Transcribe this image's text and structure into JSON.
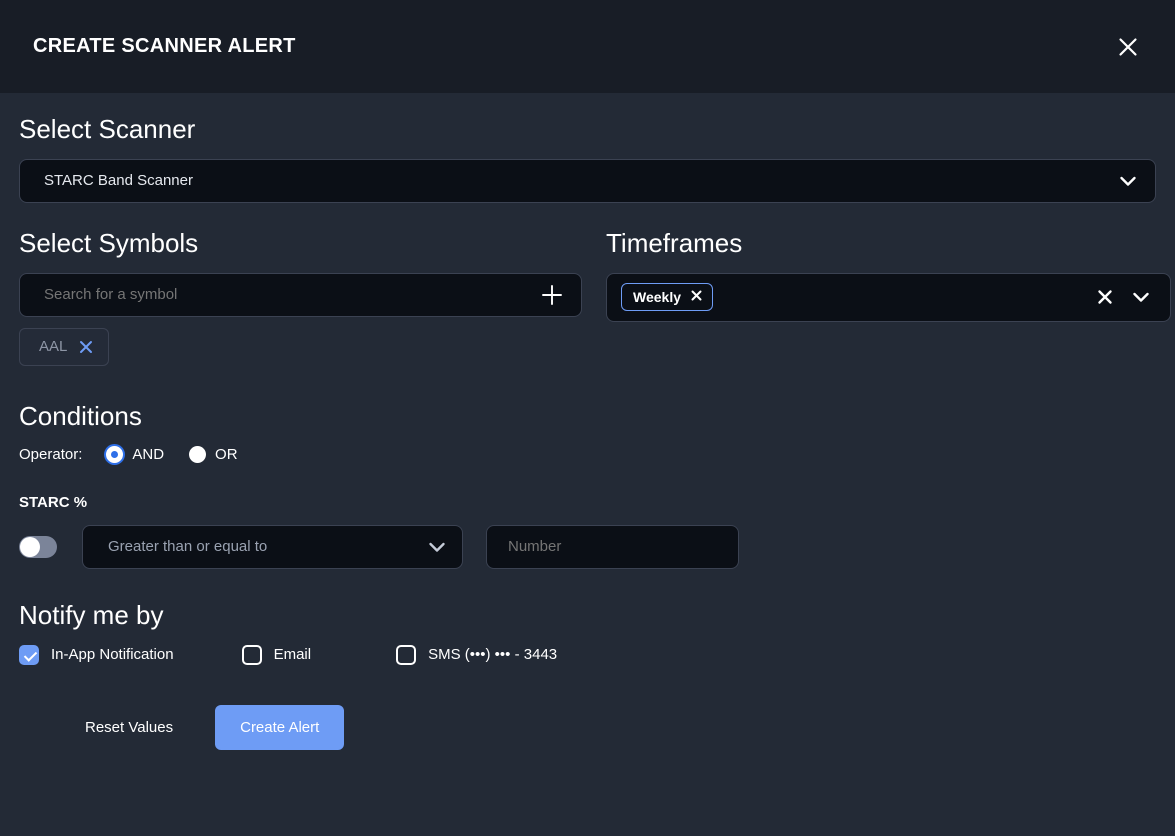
{
  "header": {
    "title": "CREATE SCANNER ALERT",
    "close_icon": "close-icon"
  },
  "scanner": {
    "heading": "Select Scanner",
    "selected": "STARC Band Scanner",
    "chevron_icon": "chevron-down-icon"
  },
  "symbols": {
    "heading": "Select Symbols",
    "search_placeholder": "Search for a symbol",
    "search_value": "",
    "add_icon": "plus-icon",
    "chips": [
      {
        "label": "AAL",
        "remove_icon": "close-icon"
      }
    ]
  },
  "timeframes": {
    "heading": "Timeframes",
    "chips": [
      {
        "label": "Weekly",
        "remove_icon": "close-icon"
      }
    ],
    "clear_icon": "close-icon",
    "chevron_icon": "chevron-down-icon"
  },
  "conditions": {
    "heading": "Conditions",
    "operator_label": "Operator:",
    "operators": [
      {
        "label": "AND",
        "selected": true
      },
      {
        "label": "OR",
        "selected": false
      }
    ],
    "rows": [
      {
        "title": "STARC %",
        "enabled": false,
        "comparator": "Greater than or equal to",
        "comparator_chevron_icon": "chevron-down-icon",
        "number_placeholder": "Number",
        "number_value": ""
      }
    ]
  },
  "notify": {
    "heading": "Notify me by",
    "options": [
      {
        "label": "In-App Notification",
        "checked": true
      },
      {
        "label": "Email",
        "checked": false
      },
      {
        "label": "SMS (•••) ••• - 3443",
        "checked": false
      }
    ]
  },
  "footer": {
    "reset_label": "Reset Values",
    "create_label": "Create Alert"
  },
  "colors": {
    "accent": "#6e9cf5",
    "radio_accent": "#2e6fe8",
    "header_bg": "#181d26",
    "body_bg": "#232a36",
    "field_bg": "#0b0f16",
    "field_border": "#3b4252"
  }
}
